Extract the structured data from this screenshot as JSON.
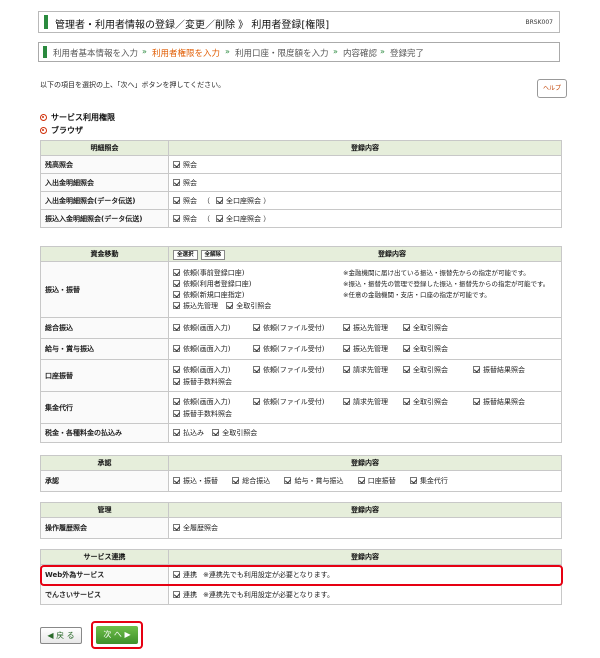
{
  "header": {
    "title": "管理者・利用者情報の登録／変更／削除 》 利用者登録[権限]",
    "screen_code": "BRSK007"
  },
  "steps": [
    {
      "label": "利用者基本情報を入力",
      "current": false
    },
    {
      "label": "利用者権限を入力",
      "current": true
    },
    {
      "label": "利用口座・限度額を入力",
      "current": false
    },
    {
      "label": "内容確認",
      "current": false
    },
    {
      "label": "登録完了",
      "current": false
    }
  ],
  "step_separator": "»",
  "intro": "以下の項目を選択の上、「次へ」ボタンを押してください。",
  "help_label": "ヘルプ",
  "sections": {
    "service": "サービス利用権限",
    "browser": "ブラウザ"
  },
  "meisai": {
    "header": [
      "明細照会",
      "登録内容"
    ],
    "rows": [
      {
        "label": "残高照会",
        "items": [
          "照会"
        ]
      },
      {
        "label": "入出金明細照会",
        "items": [
          "照会"
        ]
      },
      {
        "label": "入出金明細照会(データ伝送)",
        "items": [
          "照会"
        ],
        "paren": "全口座照会"
      },
      {
        "label": "振込入金明細照会(データ伝送)",
        "items": [
          "照会"
        ],
        "paren": "全口座照会"
      }
    ]
  },
  "shikin": {
    "header": [
      "資金移動",
      "全選択",
      "全解除",
      "登録内容"
    ],
    "furikomi": {
      "label": "振込・振替",
      "items": [
        "依頼(事前登録口座)",
        "依頼(利用者登録口座)",
        "依頼(新規口座指定)",
        "振込先管理",
        "全取引照会"
      ],
      "notes": [
        "※金融機関に届け出ている振込・振替先からの指定が可能です。",
        "※振込・振替先の管理で登録した振込・振替先からの指定が可能です。",
        "※任意の金融機関・支店・口座の指定が可能です。"
      ]
    },
    "rows": [
      {
        "label": "総合振込",
        "items": [
          "依頼(画面入力)",
          "依頼(ファイル受付)",
          "振込先管理",
          "全取引照会"
        ]
      },
      {
        "label": "給与・賞与振込",
        "items": [
          "依頼(画面入力)",
          "依頼(ファイル受付)",
          "振込先管理",
          "全取引照会"
        ]
      },
      {
        "label": "口座振替",
        "items": [
          "依頼(画面入力)",
          "依頼(ファイル受付)",
          "請求先管理",
          "全取引照会",
          "振替結果照会",
          "振替手数料照会"
        ]
      },
      {
        "label": "集金代行",
        "items": [
          "依頼(画面入力)",
          "依頼(ファイル受付)",
          "請求先管理",
          "全取引照会",
          "振替結果照会",
          "振替手数料照会"
        ]
      },
      {
        "label": "税金・各種料金の払込み",
        "items": [
          "払込み",
          "全取引照会"
        ]
      }
    ]
  },
  "shonin": {
    "header": [
      "承認",
      "登録内容"
    ],
    "row": {
      "label": "承認",
      "items": [
        "振込・振替",
        "総合振込",
        "給与・賞与振込",
        "口座振替",
        "集金代行"
      ]
    }
  },
  "kanri": {
    "header": [
      "管理",
      "登録内容"
    ],
    "row": {
      "label": "操作履歴照会",
      "items": [
        "全履歴照会"
      ]
    }
  },
  "renkei": {
    "header": [
      "サービス連携",
      "登録内容"
    ],
    "rows": [
      {
        "label": "Web外為サービス",
        "item": "連携",
        "note": "※連携先でも利用設定が必要となります。"
      },
      {
        "label": "でんさいサービス",
        "item": "連携",
        "note": "※連携先でも利用設定が必要となります。"
      }
    ]
  },
  "buttons": {
    "back": "◀ 戻 る",
    "next": "次 へ ▶"
  }
}
